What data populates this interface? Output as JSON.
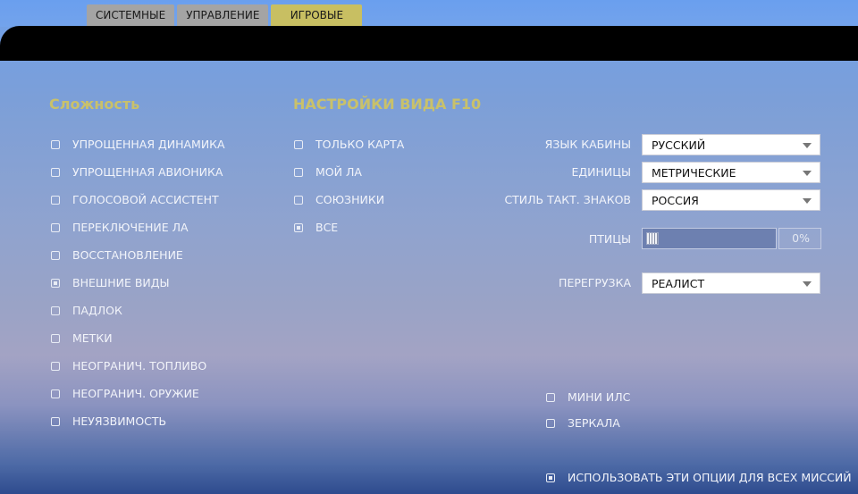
{
  "tabs": [
    {
      "label": "СИСТЕМНЫЕ",
      "active": false
    },
    {
      "label": "УПРАВЛЕНИЕ",
      "active": false
    },
    {
      "label": "ИГРОВЫЕ",
      "active": true
    }
  ],
  "difficulty": {
    "title": "Сложность",
    "items": [
      {
        "label": "УПРОЩЕННАЯ ДИНАМИКА",
        "checked": false
      },
      {
        "label": "УПРОЩЕННАЯ АВИОНИКА",
        "checked": false
      },
      {
        "label": "ГОЛОСОВОЙ АССИСТЕНТ",
        "checked": false
      },
      {
        "label": "ПЕРЕКЛЮЧЕНИЕ ЛА",
        "checked": false
      },
      {
        "label": "ВОССТАНОВЛЕНИЕ",
        "checked": false
      },
      {
        "label": "ВНЕШНИЕ ВИДЫ",
        "checked": true
      },
      {
        "label": "ПАДЛОК",
        "checked": false
      },
      {
        "label": "МЕТКИ",
        "checked": false
      },
      {
        "label": "НЕОГРАНИЧ. ТОПЛИВО",
        "checked": false
      },
      {
        "label": "НЕОГРАНИЧ. ОРУЖИЕ",
        "checked": false
      },
      {
        "label": "НЕУЯЗВИМОСТЬ",
        "checked": false
      }
    ]
  },
  "f10_view": {
    "title": "НАСТРОЙКИ ВИДА F10",
    "items": [
      {
        "label": "ТОЛЬКО КАРТА",
        "checked": false
      },
      {
        "label": "МОЙ ЛА",
        "checked": false
      },
      {
        "label": "СОЮЗНИКИ",
        "checked": false
      },
      {
        "label": "ВСЕ",
        "checked": true
      }
    ]
  },
  "settings": {
    "cockpit_language": {
      "label": "ЯЗЫК КАБИНЫ",
      "value": "РУССКИЙ"
    },
    "units": {
      "label": "ЕДИНИЦЫ",
      "value": "МЕТРИЧЕСКИЕ"
    },
    "symbol_style": {
      "label": "СТИЛЬ ТАКТ. ЗНАКОВ",
      "value": "РОССИЯ"
    },
    "birds": {
      "label": "ПТИЦЫ",
      "value": "0%",
      "fraction": 0
    },
    "g_effects": {
      "label": "ПЕРЕГРУЗКА",
      "value": "РЕАЛИСТ"
    }
  },
  "extra_options": [
    {
      "label": "МИНИ ИЛС",
      "checked": false
    },
    {
      "label": "ЗЕРКАЛА",
      "checked": false
    }
  ],
  "apply_all": {
    "label": "ИСПОЛЬЗОВАТЬ ЭТИ ОПЦИИ ДЛЯ ВСЕХ МИССИЙ",
    "checked": true
  },
  "colors": {
    "accent_title": "#c9c16a",
    "active_tab": "#c8bf62",
    "inactive_tab": "#a4a4a4"
  }
}
